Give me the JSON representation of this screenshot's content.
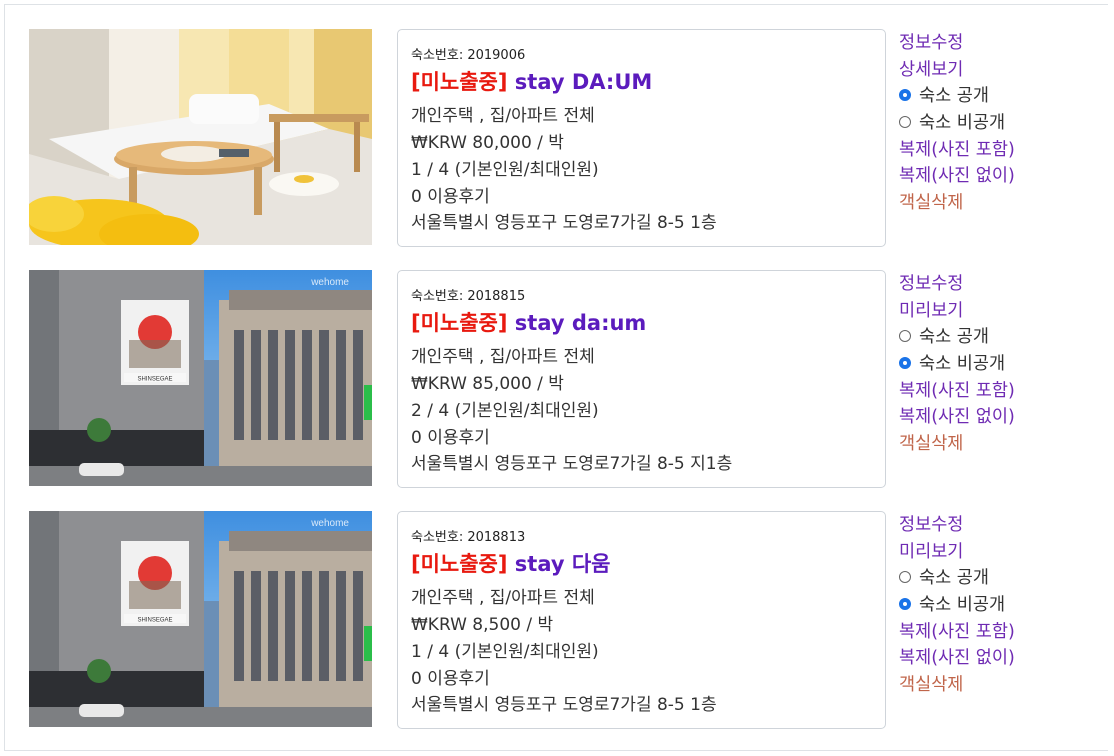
{
  "listings": [
    {
      "stay_id_label": "숙소번호: 2019006",
      "status": "[미노출중]",
      "name": "stay DA:UM",
      "type": "개인주택 , 집/아파트 전체",
      "price": "₩KRW 80,000 / 박",
      "guests": "1 / 4 (기본인원/최대인원)",
      "reviews": "0 이용후기",
      "address": "서울특별시 영등포구 도영로7가길 8-5 1층",
      "actions": {
        "edit": "정보수정",
        "view": "상세보기",
        "public": "숙소 공개",
        "private": "숙소 비공개",
        "selected": "public",
        "copy_with_photos": "복제(사진 포함)",
        "copy_without_photos": "복제(사진 없이)",
        "delete": "객실삭제"
      }
    },
    {
      "stay_id_label": "숙소번호: 2018815",
      "status": "[미노출중]",
      "name": "stay da:um",
      "type": "개인주택 , 집/아파트 전체",
      "price": "₩KRW 85,000 / 박",
      "guests": "2 / 4 (기본인원/최대인원)",
      "reviews": "0 이용후기",
      "address": "서울특별시 영등포구 도영로7가길 8-5 지1층",
      "photo_watermark": "wehome",
      "photo_sign": "SHINSEGAE",
      "actions": {
        "edit": "정보수정",
        "view": "미리보기",
        "public": "숙소 공개",
        "private": "숙소 비공개",
        "selected": "private",
        "copy_with_photos": "복제(사진 포함)",
        "copy_without_photos": "복제(사진 없이)",
        "delete": "객실삭제"
      }
    },
    {
      "stay_id_label": "숙소번호: 2018813",
      "status": "[미노출중]",
      "name": "stay 다움",
      "type": "개인주택 , 집/아파트 전체",
      "price": "₩KRW 8,500 / 박",
      "guests": "1 / 4 (기본인원/최대인원)",
      "reviews": "0 이용후기",
      "address": "서울특별시 영등포구 도영로7가길 8-5 1층",
      "photo_watermark": "wehome",
      "photo_sign": "SHINSEGAE",
      "actions": {
        "edit": "정보수정",
        "view": "미리보기",
        "public": "숙소 공개",
        "private": "숙소 비공개",
        "selected": "private",
        "copy_with_photos": "복제(사진 포함)",
        "copy_without_photos": "복제(사진 없이)",
        "delete": "객실삭제"
      }
    }
  ],
  "colors": {
    "status": "#e8190f",
    "name": "#5b1bbd",
    "link": "#6f2bb3",
    "delete": "#c0654a",
    "radio_on": "#1a73e8"
  }
}
